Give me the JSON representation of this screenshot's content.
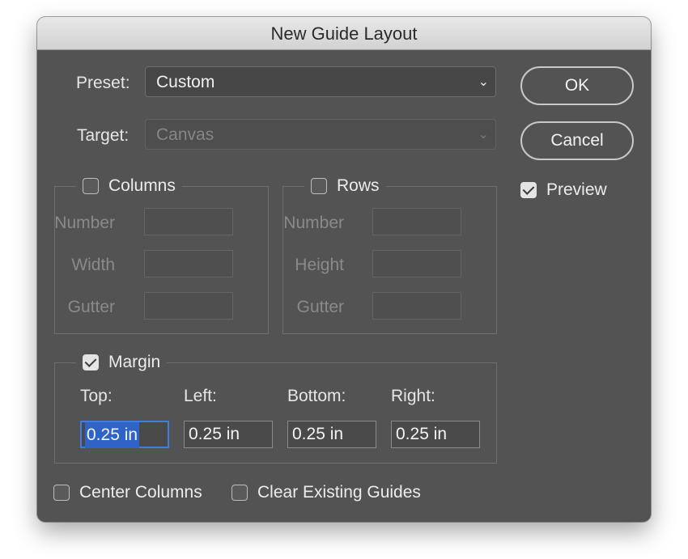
{
  "dialog": {
    "title": "New Guide Layout",
    "preset_label": "Preset:",
    "preset_value": "Custom",
    "target_label": "Target:",
    "target_value": "Canvas",
    "ok_label": "OK",
    "cancel_label": "Cancel",
    "preview_label": "Preview",
    "preview_checked": true
  },
  "columns": {
    "label": "Columns",
    "checked": false,
    "number_label": "Number",
    "width_label": "Width",
    "gutter_label": "Gutter"
  },
  "rows": {
    "label": "Rows",
    "checked": false,
    "number_label": "Number",
    "height_label": "Height",
    "gutter_label": "Gutter"
  },
  "margin": {
    "label": "Margin",
    "checked": true,
    "top_label": "Top:",
    "left_label": "Left:",
    "bottom_label": "Bottom:",
    "right_label": "Right:",
    "top_value": "0.25 in",
    "left_value": "0.25 in",
    "bottom_value": "0.25 in",
    "right_value": "0.25 in"
  },
  "options": {
    "center_columns_label": "Center Columns",
    "center_columns_checked": false,
    "clear_guides_label": "Clear Existing Guides",
    "clear_guides_checked": false
  },
  "icons": {
    "dropdown": "chevron-down-icon",
    "checkbox_checked": "checkmark-icon"
  },
  "colors": {
    "dialog_bg": "#535353",
    "selection": "#2f64c6",
    "focus_ring": "#3f7de0"
  }
}
